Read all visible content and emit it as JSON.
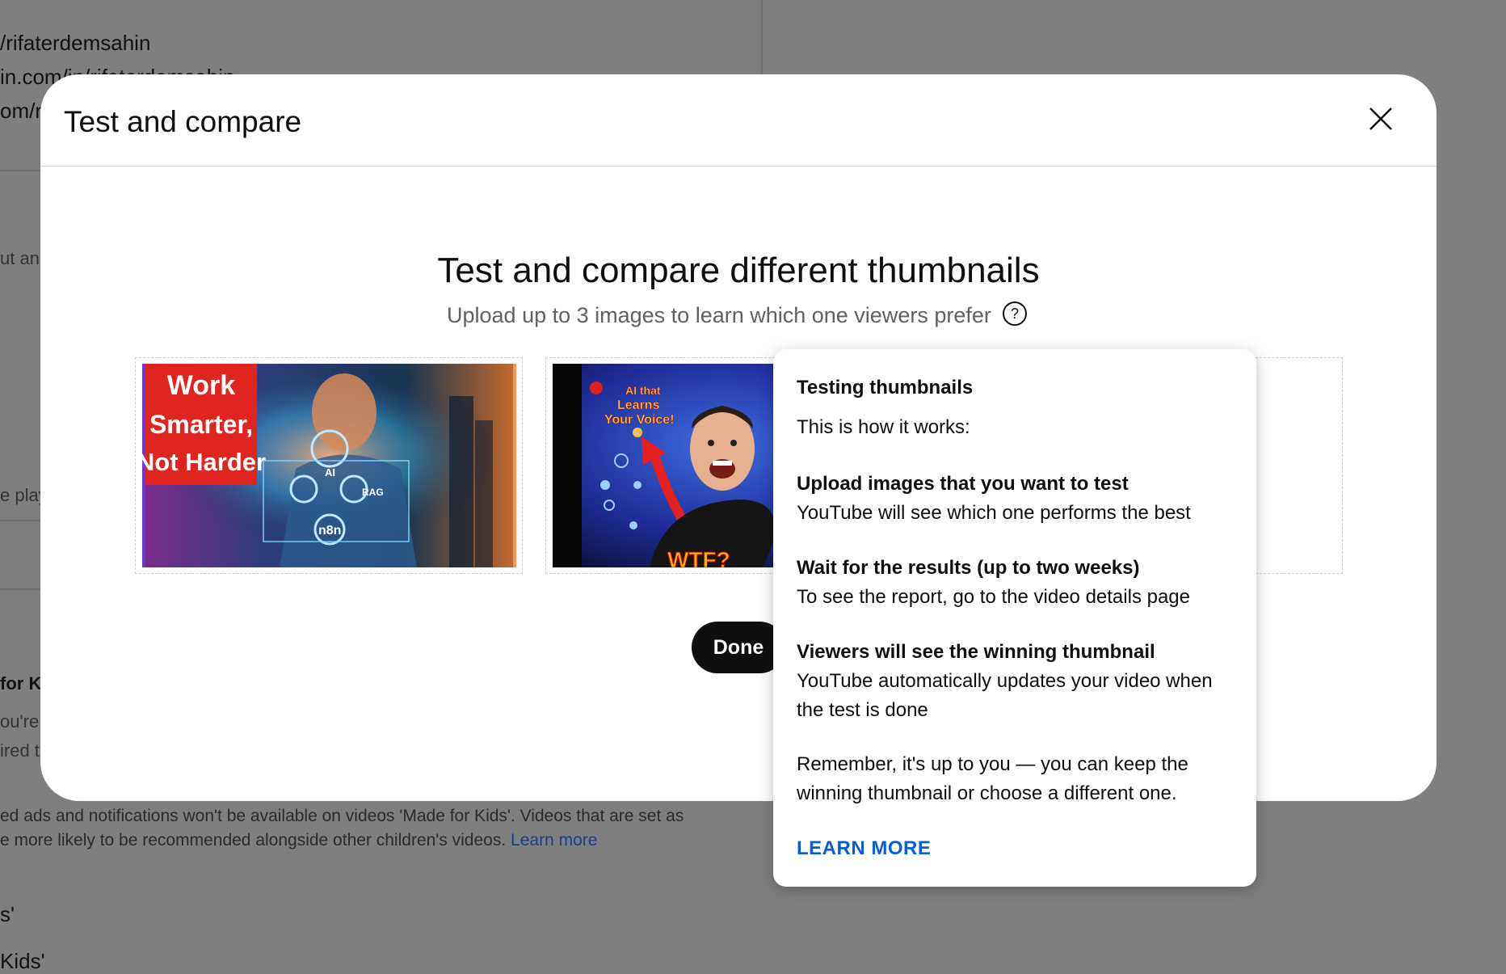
{
  "background": {
    "line1": "/rifaterdemsahin",
    "line2": "in.com/in/rifaterdemsahin",
    "line3": "om/r",
    "frag1": "ut an",
    "frag2": "e play",
    "frag3": "for K",
    "frag4": "ou're",
    "frag5": "ired t",
    "paragraph_line1": "ed ads and notifications won't be available on videos 'Made for Kids'. Videos that are set as",
    "paragraph_line2": "e more likely to be recommended alongside other children's videos.",
    "learn_more": "Learn more",
    "option1": "s'",
    "option2": "Kids'"
  },
  "dialog": {
    "title": "Test and compare",
    "heading": "Test and compare different thumbnails",
    "subheading": "Upload up to 3 images to learn which one viewers prefer",
    "done_label": "Done",
    "thumbnails": [
      {
        "text_lines": [
          "Work",
          "Smarter,",
          "Not Harder"
        ],
        "icons": [
          "AI",
          "RAG",
          "n8n"
        ]
      },
      {
        "text_lines": [
          "AI that",
          "Learns",
          "Your Voice!"
        ],
        "corner_text": "WTF?"
      }
    ]
  },
  "popup": {
    "title": "Testing thumbnails",
    "intro": "This is how it works:",
    "steps": [
      {
        "heading": "Upload images that you want to test",
        "body": "YouTube will see which one performs the best"
      },
      {
        "heading": "Wait for the results (up to two weeks)",
        "body": "To see the report, go to the video details page"
      },
      {
        "heading": "Viewers will see the winning thumbnail",
        "body": "YouTube automatically updates your video when the test is done"
      }
    ],
    "remember": "Remember, it's up to you — you can keep the winning thumbnail or choose a different one.",
    "learn_more": "LEARN MORE"
  }
}
